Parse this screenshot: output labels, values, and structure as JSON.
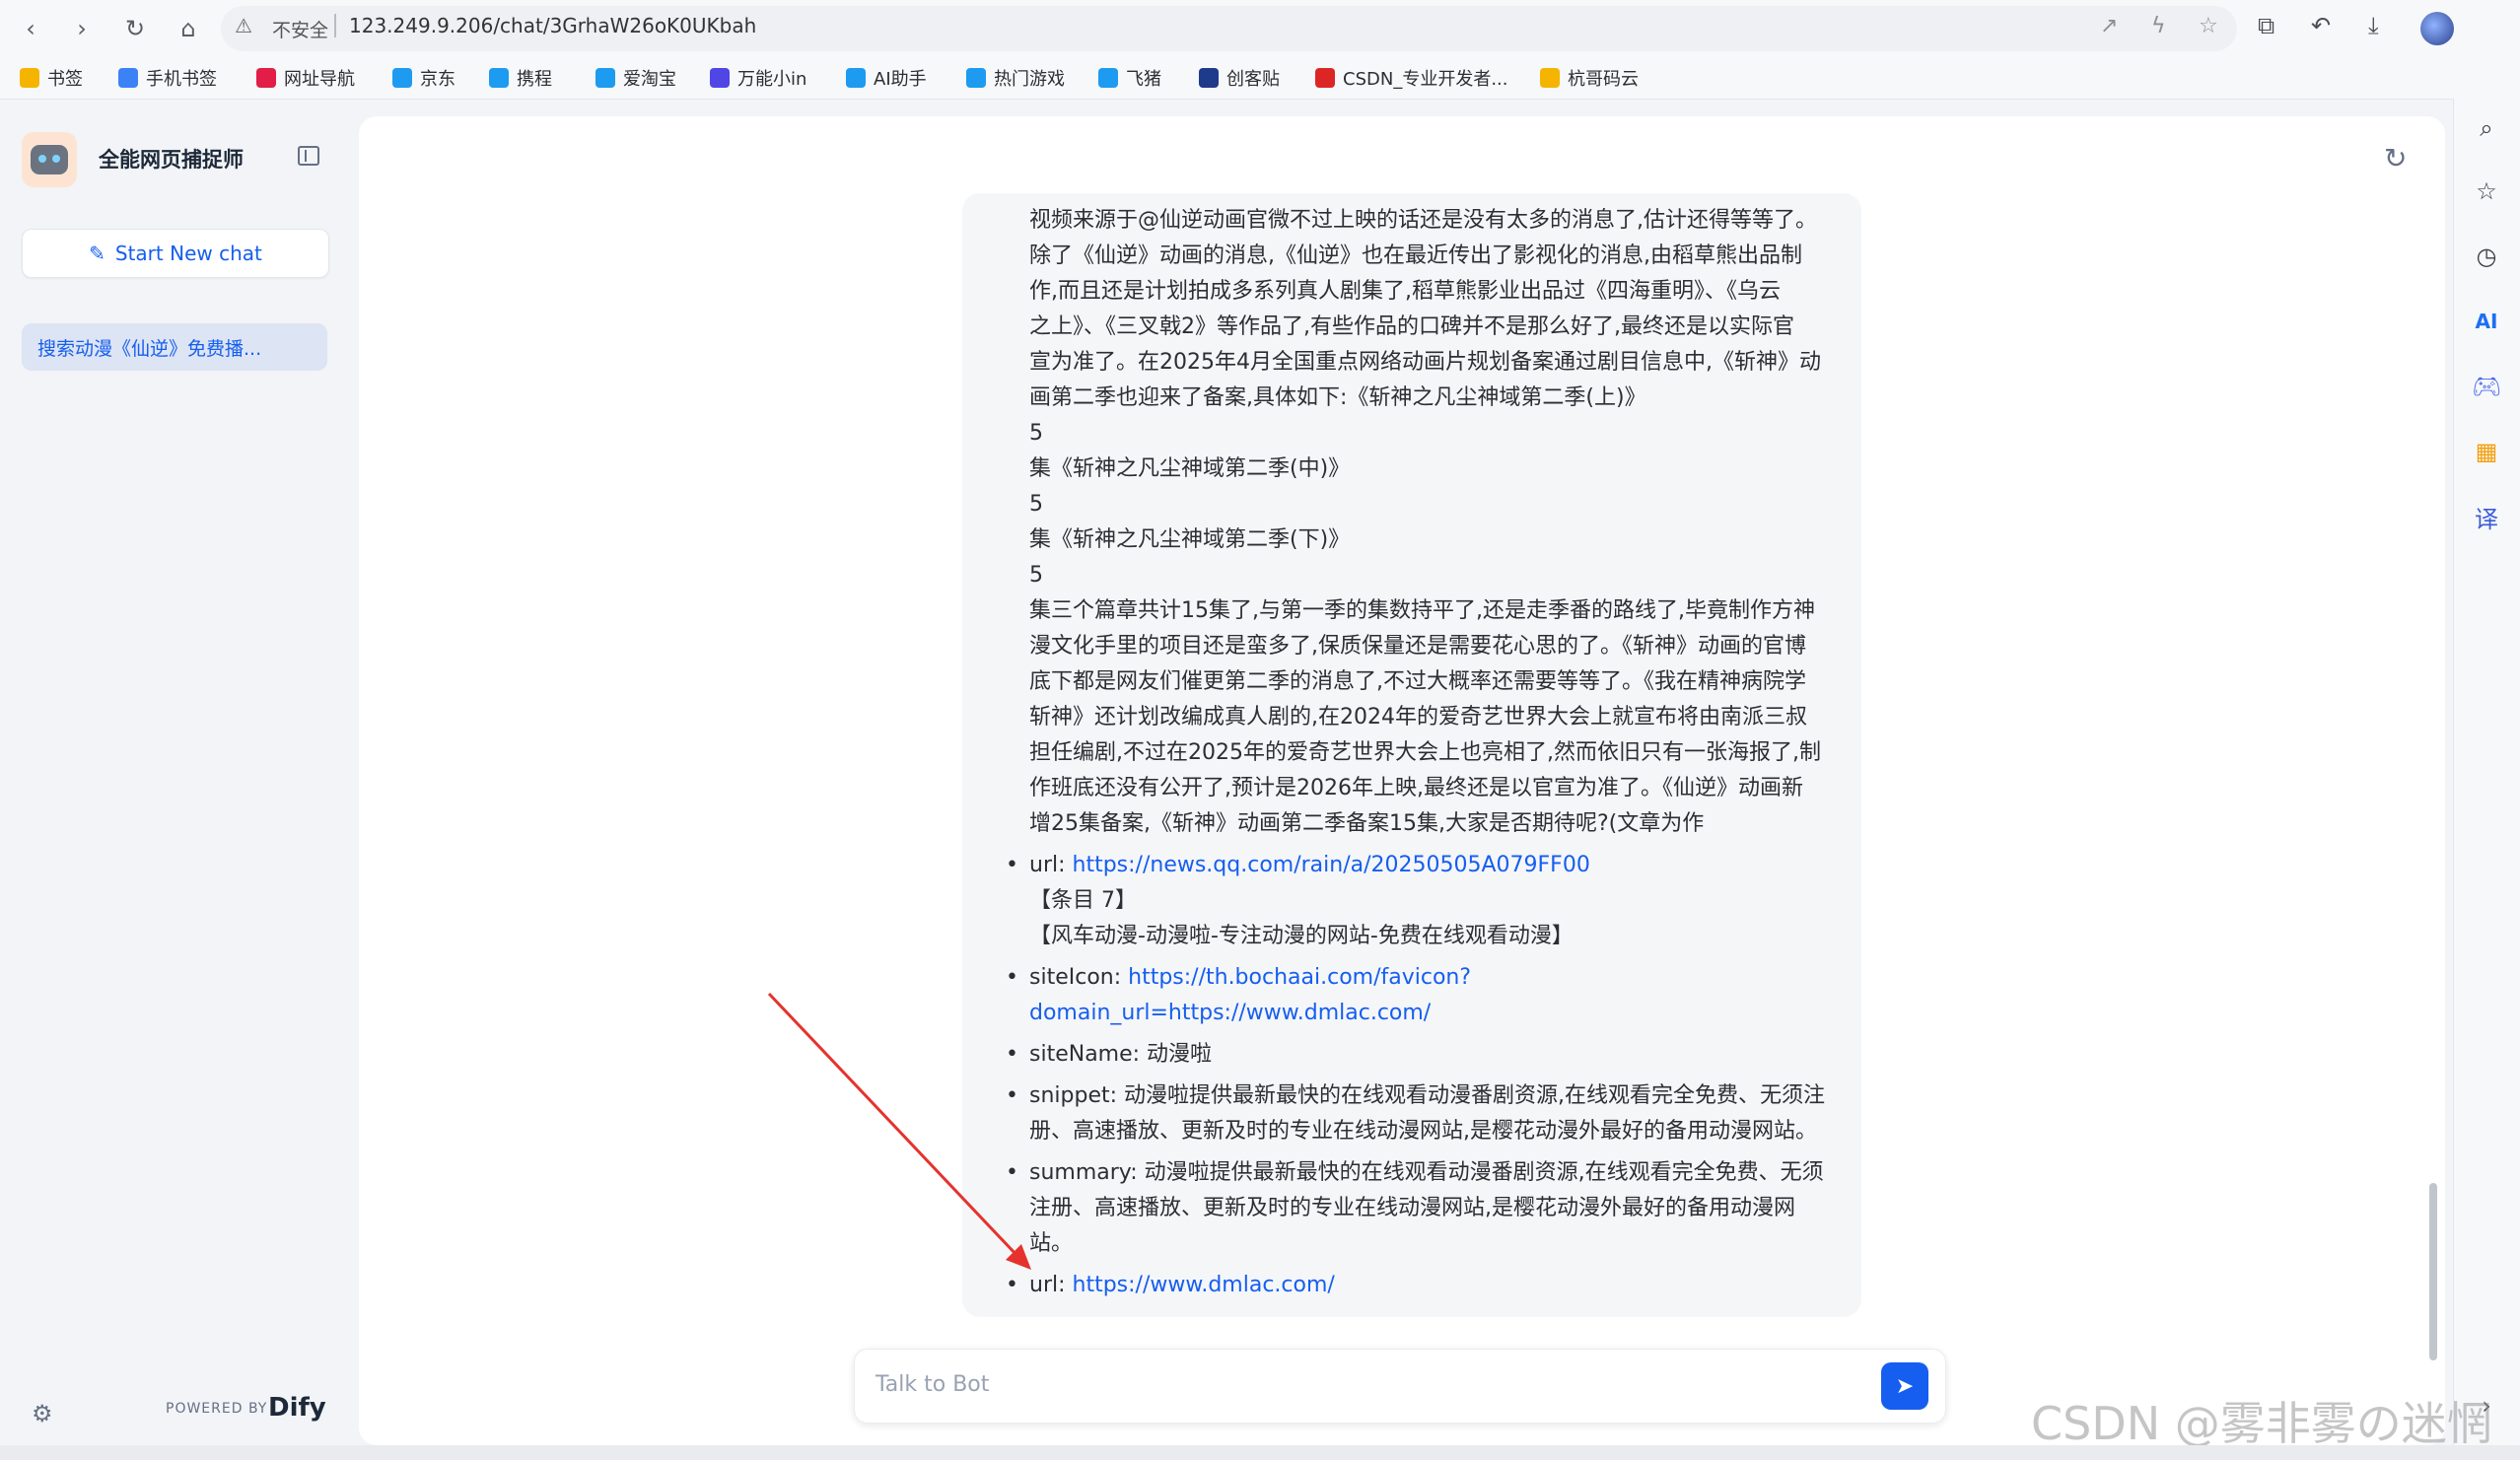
{
  "browser": {
    "insecure_label": "不安全",
    "url": "123.249.9.206/chat/3GrhaW26oK0UKbah",
    "bookmarks": [
      {
        "label": "书签",
        "color": "#f5b400"
      },
      {
        "label": "手机书签",
        "color": "#3b82f6"
      },
      {
        "label": "网址导航",
        "color": "#e11d48"
      },
      {
        "label": "京东",
        "color": "#1d9bf0"
      },
      {
        "label": "携程",
        "color": "#1d9bf0"
      },
      {
        "label": "爱淘宝",
        "color": "#1d9bf0"
      },
      {
        "label": "万能小in",
        "color": "#4f46e5"
      },
      {
        "label": "AI助手",
        "color": "#1d9bf0"
      },
      {
        "label": "热门游戏",
        "color": "#1d9bf0"
      },
      {
        "label": "飞猪",
        "color": "#1d9bf0"
      },
      {
        "label": "创客贴",
        "color": "#1e3a8a"
      },
      {
        "label": "CSDN_专业开发者...",
        "color": "#dc2626"
      },
      {
        "label": "杭哥码云",
        "color": "#f5b400"
      }
    ]
  },
  "app": {
    "title": "全能网页捕捉师",
    "new_chat_label": "Start New chat",
    "conversation_title": "搜索动漫《仙逆》免费播...",
    "powered_by": "POWERED BY",
    "brand": "Dify"
  },
  "message": {
    "paragraph_lines": [
      "视频来源于@仙逆动画官微不过上映的话还是没有太多的消息了,估计还得等等了。",
      "除了《仙逆》动画的消息,《仙逆》也在最近传出了影视化的消息,由稻草熊出品制",
      "作,而且还是计划拍成多系列真人剧集了,稻草熊影业出品过《四海重明》、《乌云",
      "之上》、《三叉戟2》等作品了,有些作品的口碑并不是那么好了,最终还是以实际官",
      "宣为准了。在2025年4月全国重点网络动画片规划备案通过剧目信息中,《斩神》动",
      "画第二季也迎来了备案,具体如下:《斩神之凡尘神域第二季(上)》",
      "5",
      "集《斩神之凡尘神域第二季(中)》",
      "5",
      "集《斩神之凡尘神域第二季(下)》",
      "5",
      "集三个篇章共计15集了,与第一季的集数持平了,还是走季番的路线了,毕竟制作方神",
      "漫文化手里的项目还是蛮多了,保质保量还是需要花心思的了。《斩神》动画的官博",
      "底下都是网友们催更第二季的消息了,不过大概率还需要等等了。《我在精神病院学",
      "斩神》还计划改编成真人剧的,在2024年的爱奇艺世界大会上就宣布将由南派三叔",
      "担任编剧,不过在2025年的爱奇艺世界大会上也亮相了,然而依旧只有一张海报了,制",
      "作班底还没有公开了,预计是2026年上映,最终还是以官宣为准了。《仙逆》动画新",
      "增25集备案,《斩神》动画第二季备案15集,大家是否期待呢?(文章为作"
    ],
    "item6_url_key": "url: ",
    "item6_url": "https://news.qq.com/rain/a/20250505A079FF00",
    "item7_heading": "【条目 7】",
    "item7_title": "【风车动漫-动漫啦-专注动漫的网站-免费在线观看动漫】",
    "siteicon_key": "siteIcon: ",
    "siteicon_url_line1": "https://th.bochaai.com/favicon?",
    "siteicon_url_line2": "domain_url=https://www.dmlac.com/",
    "sitename_key": "siteName: ",
    "sitename_val": "动漫啦",
    "snippet_key": "snippet: ",
    "snippet_val": "动漫啦提供最新最快的在线观看动漫番剧资源,在线观看完全免费、无须注册、高速播放、更新及时的专业在线动漫网站,是樱花动漫外最好的备用动漫网站。",
    "summary_key": "summary: ",
    "summary_val": "动漫啦提供最新最快的在线观看动漫番剧资源,在线观看完全免费、无须注册、高速播放、更新及时的专业在线动漫网站,是樱花动漫外最好的备用动漫网站。",
    "url_key": "url: ",
    "url_val": "https://www.dmlac.com/"
  },
  "input": {
    "placeholder": "Talk to Bot"
  },
  "watermark": "CSDN @雾非雾の迷惘",
  "colors": {
    "accent": "#155eef",
    "annotation_arrow": "#e5322d"
  }
}
